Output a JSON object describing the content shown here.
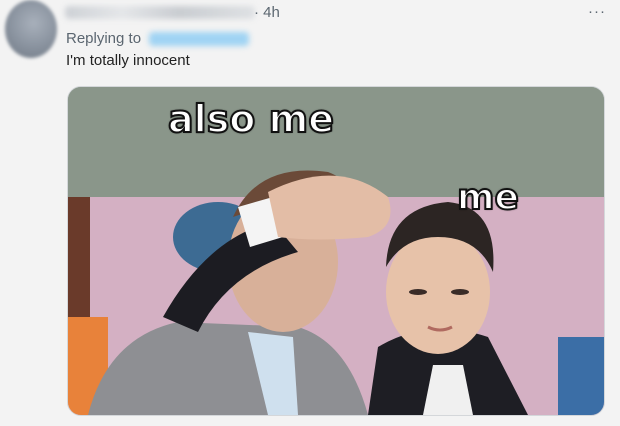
{
  "tweet": {
    "time": "· 4h",
    "more": "···",
    "replying_label": "Replying to",
    "text": "I'm totally innocent"
  },
  "media": {
    "caption_top": "also me",
    "caption_right": "me"
  }
}
